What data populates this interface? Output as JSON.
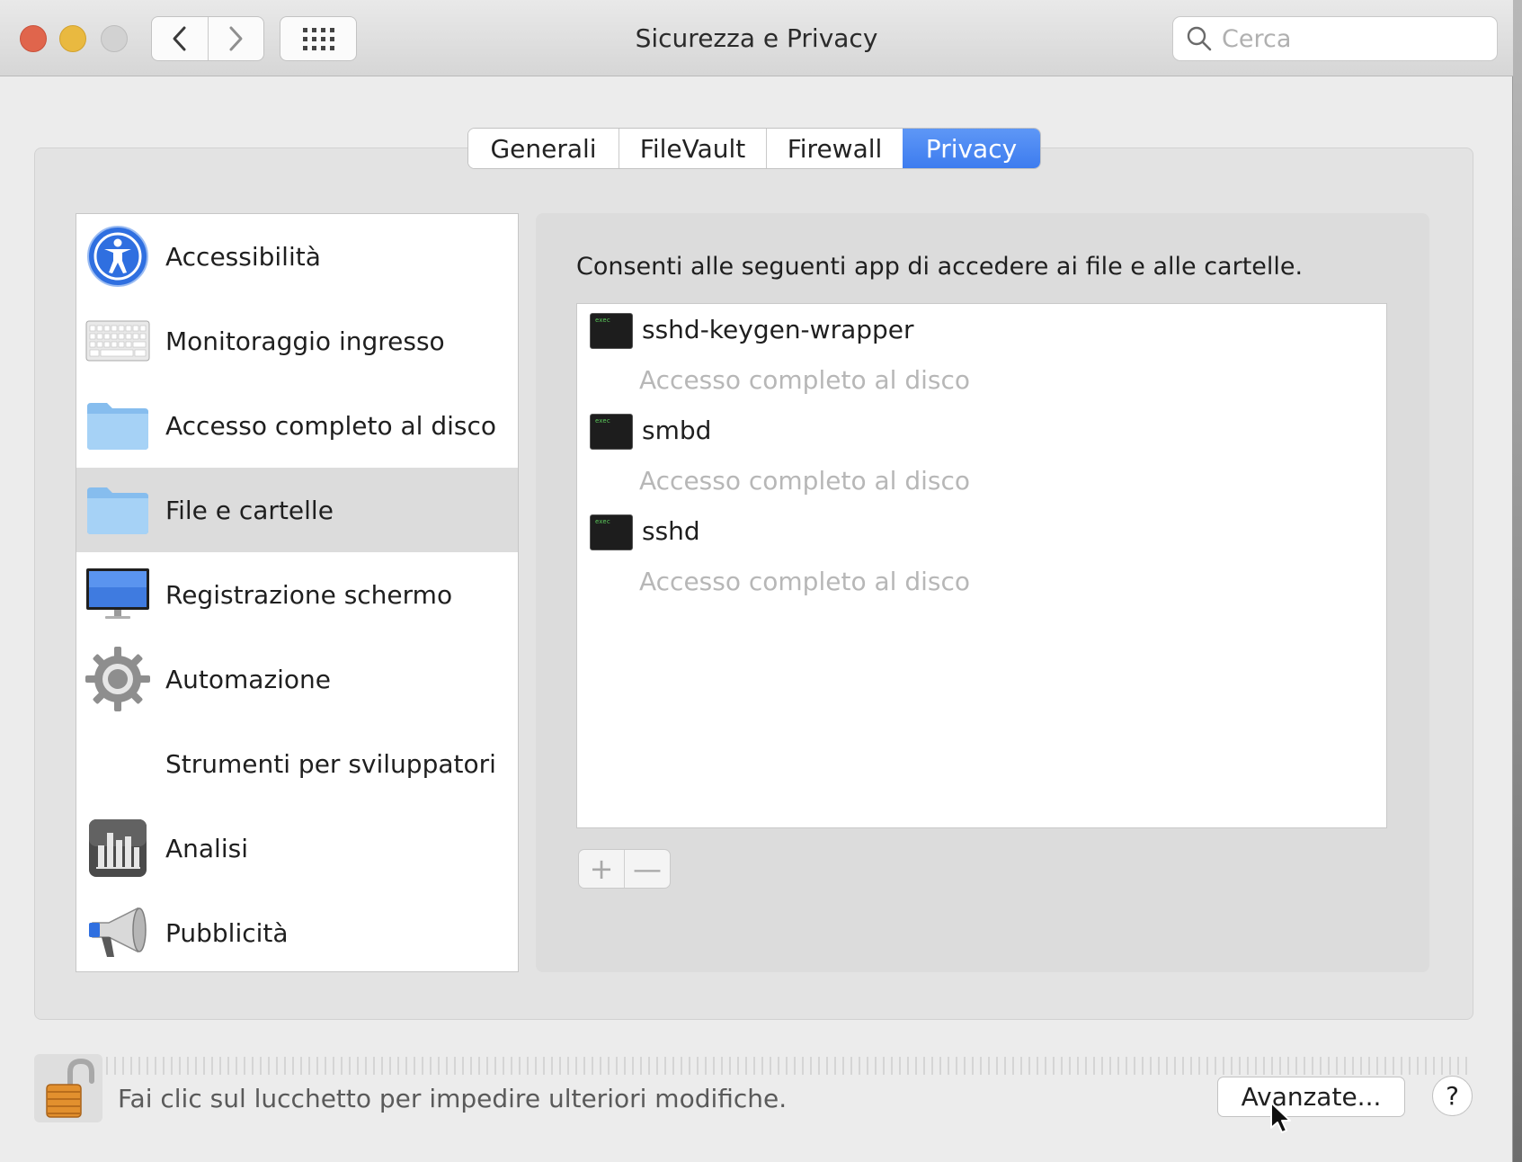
{
  "window": {
    "title": "Sicurezza e Privacy"
  },
  "search": {
    "placeholder": "Cerca"
  },
  "tabs": [
    {
      "label": "Generali"
    },
    {
      "label": "FileVault"
    },
    {
      "label": "Firewall"
    },
    {
      "label": "Privacy",
      "active": true
    }
  ],
  "categories": [
    {
      "label": "Accessibilità",
      "icon": "accessibility-icon"
    },
    {
      "label": "Monitoraggio ingresso",
      "icon": "keyboard-icon"
    },
    {
      "label": "Accesso completo al disco",
      "icon": "folder-icon"
    },
    {
      "label": "File e cartelle",
      "icon": "folder-icon",
      "selected": true
    },
    {
      "label": "Registrazione schermo",
      "icon": "monitor-icon"
    },
    {
      "label": "Automazione",
      "icon": "gear-icon"
    },
    {
      "label": "Strumenti per sviluppatori",
      "icon": ""
    },
    {
      "label": "Analisi",
      "icon": "chart-icon"
    },
    {
      "label": "Pubblicità",
      "icon": "megaphone-icon"
    }
  ],
  "panel": {
    "description": "Consenti alle seguenti app di accedere ai file e alle cartelle.",
    "apps": [
      {
        "name": "sshd-keygen-wrapper",
        "subtitle": "Accesso completo al disco",
        "icon_text": "exec"
      },
      {
        "name": "smbd",
        "subtitle": "Accesso completo al disco",
        "icon_text": "exec"
      },
      {
        "name": "sshd",
        "subtitle": "Accesso completo al disco",
        "icon_text": "exec"
      }
    ],
    "add_label": "+",
    "remove_label": "—"
  },
  "footer": {
    "lock_text": "Fai clic sul lucchetto per impedire ulteriori modifiche.",
    "advanced_label": "Avanzate...",
    "help_label": "?"
  },
  "colors": {
    "accent": "#3d7cef",
    "close": "#e0654c",
    "minimize": "#e9b940",
    "zoom_disabled": "#d2d2d2"
  }
}
